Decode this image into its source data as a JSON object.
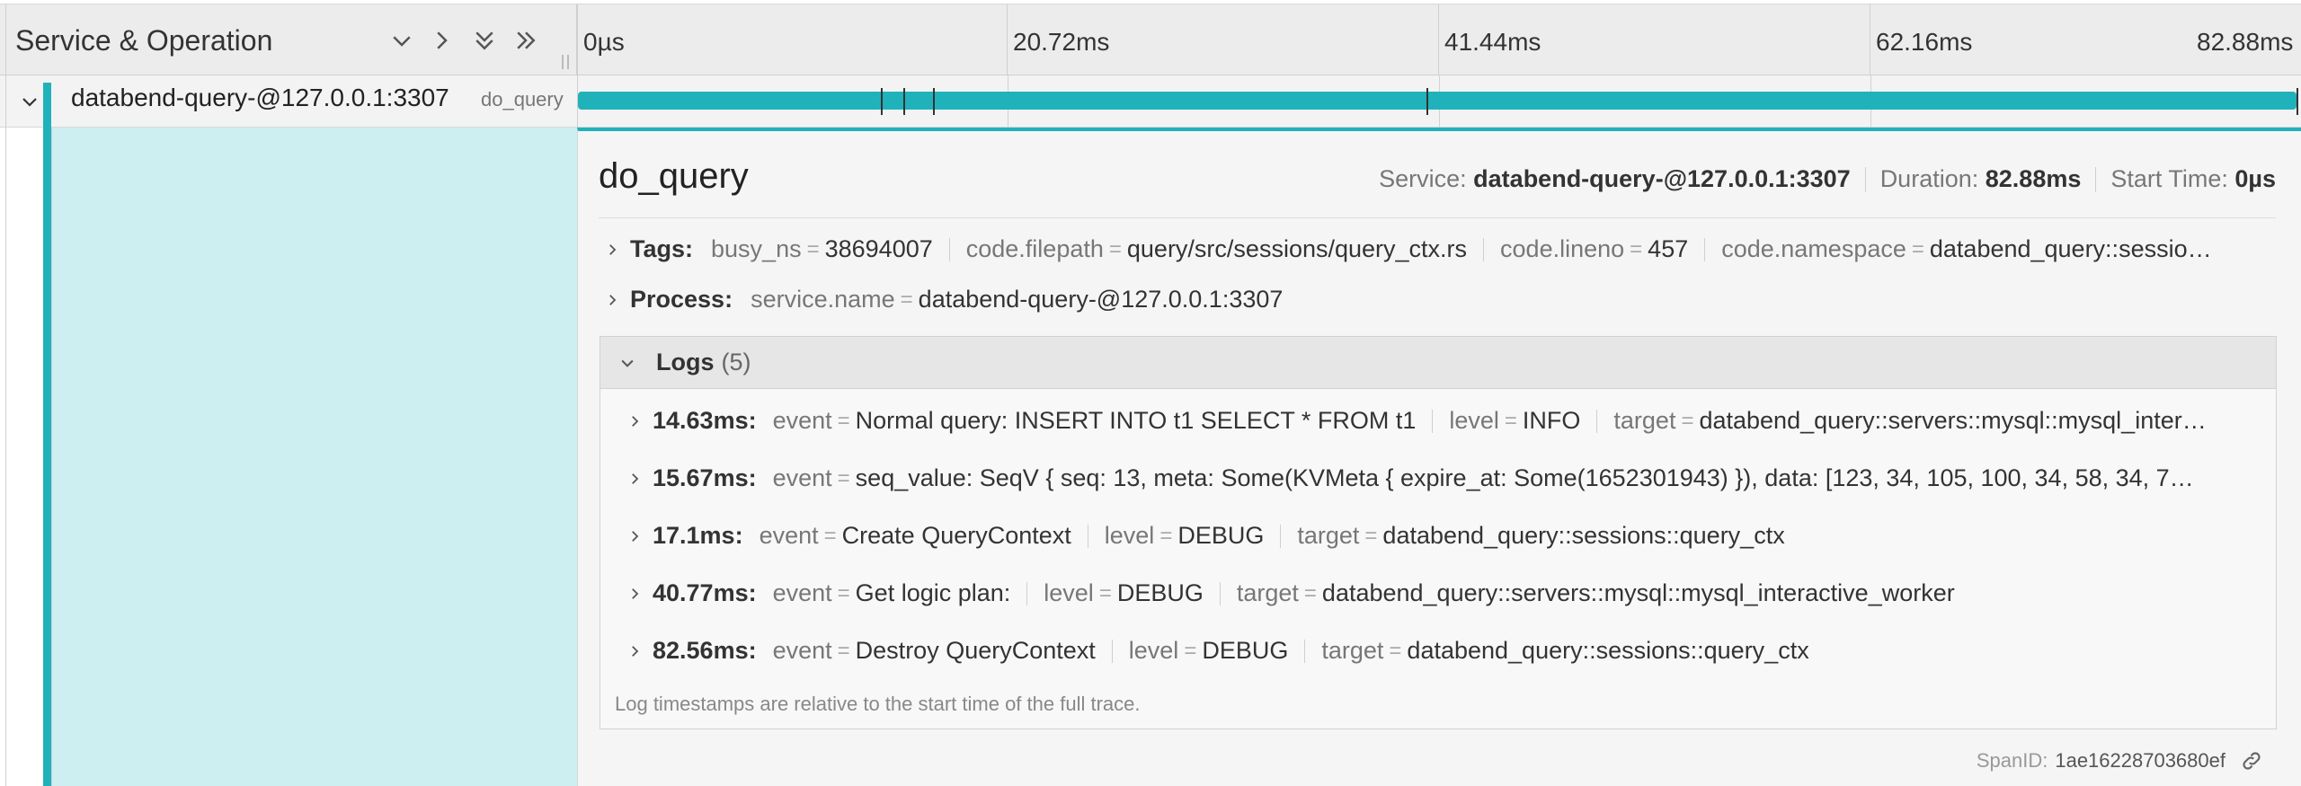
{
  "header": {
    "title": "Service & Operation",
    "ticks": [
      "0µs",
      "20.72ms",
      "41.44ms",
      "62.16ms",
      "82.88ms"
    ]
  },
  "span": {
    "service": "databend-query-@127.0.0.1:3307",
    "operation": "do_query"
  },
  "detail": {
    "operation": "do_query",
    "service_label": "Service:",
    "service_value": "databend-query-@127.0.0.1:3307",
    "duration_label": "Duration:",
    "duration_value": "82.88ms",
    "start_label": "Start Time:",
    "start_value": "0µs",
    "tags": {
      "title": "Tags:",
      "items": [
        {
          "key": "busy_ns",
          "value": "38694007"
        },
        {
          "key": "code.filepath",
          "value": "query/src/sessions/query_ctx.rs"
        },
        {
          "key": "code.lineno",
          "value": "457"
        },
        {
          "key": "code.namespace",
          "value": "databend_query::sessio…"
        }
      ]
    },
    "process": {
      "title": "Process:",
      "items": [
        {
          "key": "service.name",
          "value": "databend-query-@127.0.0.1:3307"
        }
      ]
    },
    "logs": {
      "title": "Logs",
      "count": "(5)",
      "entries": [
        {
          "ts": "14.63ms:",
          "fields": [
            {
              "key": "event",
              "value": "Normal query: INSERT INTO t1 SELECT * FROM t1"
            },
            {
              "key": "level",
              "value": "INFO"
            },
            {
              "key": "target",
              "value": "databend_query::servers::mysql::mysql_inter…"
            }
          ]
        },
        {
          "ts": "15.67ms:",
          "fields": [
            {
              "key": "event",
              "value": "seq_value: SeqV { seq: 13, meta: Some(KVMeta { expire_at: Some(1652301943) }), data: [123, 34, 105, 100, 34, 58, 34, 7…"
            }
          ]
        },
        {
          "ts": "17.1ms:",
          "fields": [
            {
              "key": "event",
              "value": "Create QueryContext"
            },
            {
              "key": "level",
              "value": "DEBUG"
            },
            {
              "key": "target",
              "value": "databend_query::sessions::query_ctx"
            }
          ]
        },
        {
          "ts": "40.77ms:",
          "fields": [
            {
              "key": "event",
              "value": "Get logic plan:"
            },
            {
              "key": "level",
              "value": "DEBUG"
            },
            {
              "key": "target",
              "value": "databend_query::servers::mysql::mysql_interactive_worker"
            }
          ]
        },
        {
          "ts": "82.56ms:",
          "fields": [
            {
              "key": "event",
              "value": "Destroy QueryContext"
            },
            {
              "key": "level",
              "value": "DEBUG"
            },
            {
              "key": "target",
              "value": "databend_query::sessions::query_ctx"
            }
          ]
        }
      ],
      "note": "Log timestamps are relative to the start time of the full trace."
    },
    "span_id_label": "SpanID:",
    "span_id_value": "1ae16228703680ef"
  },
  "colors": {
    "accent": "#1fb2ba",
    "detail_left": "#cdeff1"
  },
  "icons": {
    "collapse_one": "chevron-down-icon",
    "expand_one": "chevron-right-icon",
    "collapse_all": "double-chevron-down-icon",
    "expand_all": "double-chevron-right-icon",
    "link": "link-icon"
  }
}
